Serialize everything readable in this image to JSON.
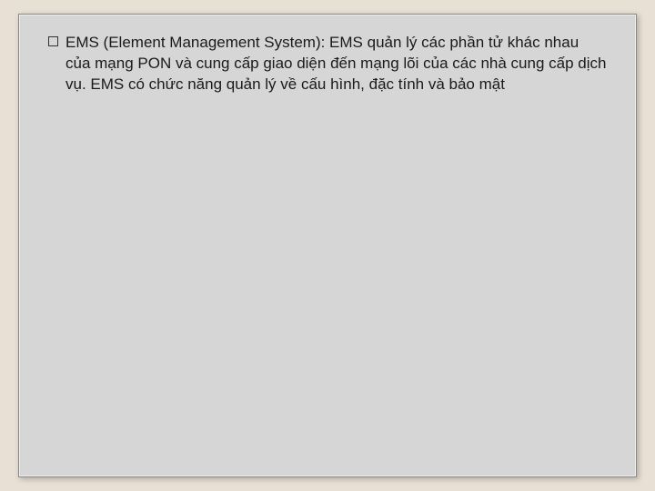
{
  "slide": {
    "bullets": [
      {
        "text": "EMS (Element Management System): EMS quản lý các phần tử khác nhau của mạng PON và cung cấp giao diện đến mạng lõi của các nhà cung cấp dịch vụ. EMS có chức năng quản lý về cấu hình, đặc tính và bảo mật"
      }
    ]
  }
}
